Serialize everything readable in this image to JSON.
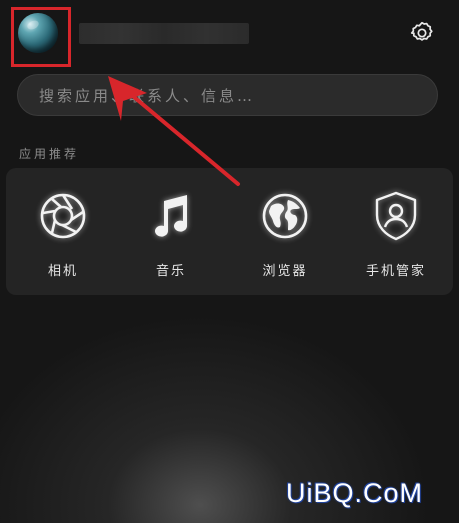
{
  "header": {
    "avatar_icon": "avatar-planet-icon",
    "username": "",
    "settings_icon": "gear-icon"
  },
  "search": {
    "placeholder": "搜索应用、联系人、信息…"
  },
  "section": {
    "title": "应用推荐"
  },
  "apps": [
    {
      "label": "相机",
      "icon": "camera-aperture-icon"
    },
    {
      "label": "音乐",
      "icon": "music-note-icon"
    },
    {
      "label": "浏览器",
      "icon": "globe-icon"
    },
    {
      "label": "手机管家",
      "icon": "shield-user-icon"
    }
  ],
  "annotation": {
    "highlight_color": "#d8262b",
    "arrow_color": "#d8262b"
  },
  "watermark": {
    "text": "UiBQ.CoM"
  }
}
